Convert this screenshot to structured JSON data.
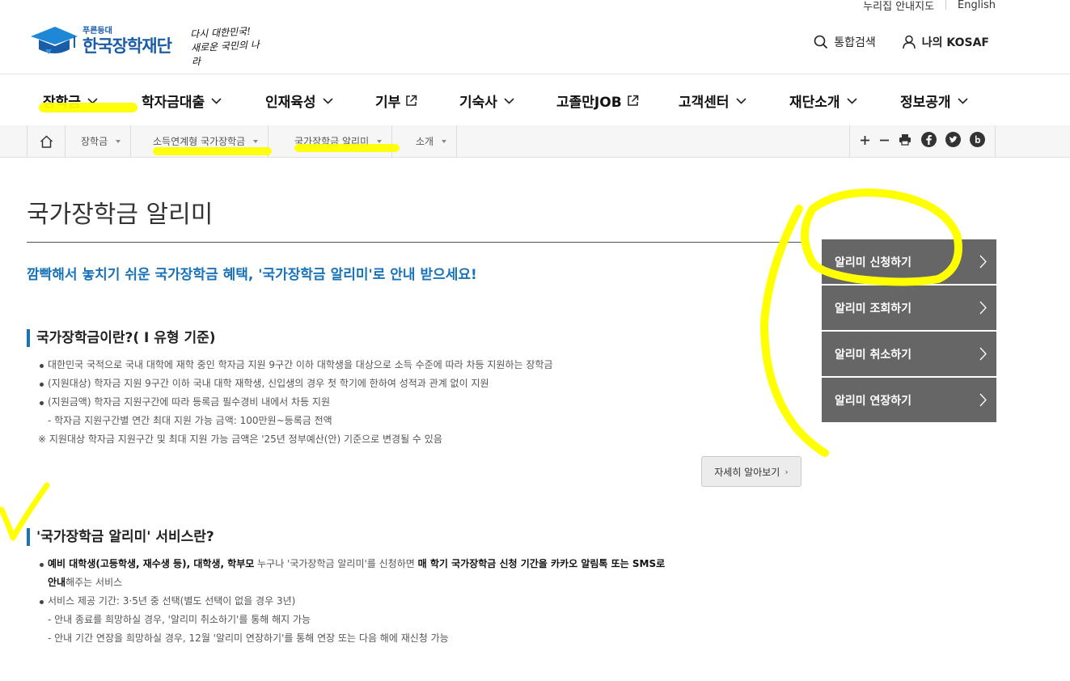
{
  "utility": {
    "left": "누리집 안내지도",
    "right": "English"
  },
  "header": {
    "logo_sub": "푸른등대",
    "logo_main": "한국장학재단",
    "slogan_line1": "다시 대한민국!",
    "slogan_line2": "새로운 국민의 나라",
    "search_label": "통합검색",
    "my_label": "나의 KOSAF"
  },
  "gnb": [
    {
      "label": "장학금",
      "icon": "chevron-down-icon"
    },
    {
      "label": "학자금대출",
      "icon": "chevron-down-icon"
    },
    {
      "label": "인재육성",
      "icon": "chevron-down-icon"
    },
    {
      "label": "기부",
      "icon": "external-link-icon"
    },
    {
      "label": "기숙사",
      "icon": "chevron-down-icon"
    },
    {
      "label": "고졸만JOB",
      "icon": "external-link-icon"
    },
    {
      "label": "고객센터",
      "icon": "chevron-down-icon"
    },
    {
      "label": "재단소개",
      "icon": "chevron-down-icon"
    },
    {
      "label": "정보공개",
      "icon": "chevron-down-icon"
    }
  ],
  "breadcrumb": [
    "장학금",
    "소득연계형 국가장학금",
    "국가장학금 알리미",
    "소개"
  ],
  "tools": [
    "plus-icon",
    "minus-icon",
    "print-icon",
    "facebook-icon",
    "twitter-icon",
    "blog-icon"
  ],
  "page": {
    "title": "국가장학금 알리미",
    "lead": "깜빡해서 놓치기 쉬운 국가장학금 혜택, '국가장학금 알리미'로 안내 받으세요!",
    "section1": {
      "heading": "국가장학금이란?( I 유형 기준)",
      "items": [
        "대한민국 국적으로 국내 대학에 재학 중인 학자금 지원 9구간 이하 대학생을 대상으로 소득 수준에 따라 차등 지원하는 장학금",
        "(지원대상) 학자금 지원 9구간 이하 국내 대학 재학생, 신입생의 경우 첫 학기에 한하여 성적과 관계 없이 지원",
        "(지원금액) 학자금 지원구간에 따라 등록금 필수경비 내에서 차등 지원",
        "- 학자금 지원구간별 연간 최대 지원 가능 금액: 100만원~등록금 전액",
        "※ 지원대상 학자금 지원구간 및 최대 지원 가능 금액은 '25년 정부예산(안) 기준으로 변경될 수 있음"
      ],
      "more_button": "자세히 알아보기"
    },
    "section2": {
      "heading": "'국가장학금 알리미' 서비스란?",
      "item1_bold1": "예비 대학생(고등학생, 재수생 등), 대학생, 학부모",
      "item1_mid": " 누구나 '국가장학금 알리미'를 신청하면 ",
      "item1_bold2": "매 학기 국가장학금 신청 기간을 카카오 알림톡 또는 SMS로",
      "item1_bold3": "안내",
      "item1_end": "해주는 서비스",
      "item2": "서비스 제공 기간: 3·5년 중 선택(별도 선택이 없을 경우 3년)",
      "item3": "- 안내 종료를 희망하실 경우, '알리미 취소하기'를 통해 해지 가능",
      "item4": "- 안내 기간 연장을 희망하실 경우, 12월 '알리미 연장하기'를 통해 연장 또는 다음 해에 재신청 가능"
    }
  },
  "side_menu": [
    "알리미 신청하기",
    "알리미 조회하기",
    "알리미 취소하기",
    "알리미 연장하기"
  ],
  "colors": {
    "accent": "#1a73b8",
    "brand": "#1a5ca8",
    "side_bg": "#666666",
    "highlighter": "#ffff00"
  }
}
